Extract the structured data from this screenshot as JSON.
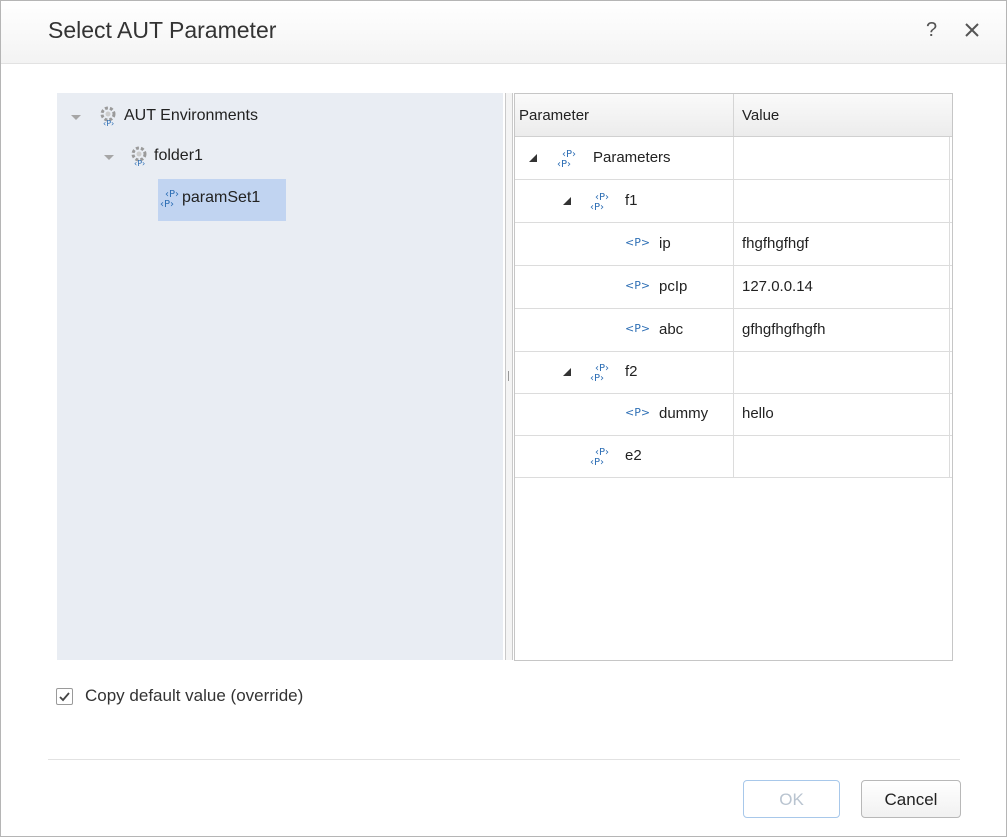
{
  "dialog": {
    "title": "Select AUT Parameter",
    "help_label": "?"
  },
  "tree": {
    "root": {
      "label": "AUT Environments",
      "icon": "gear-param-icon"
    },
    "folder": {
      "label": "folder1",
      "icon": "gear-param-icon"
    },
    "selected": {
      "label": "paramSet1",
      "icon": "param-set-icon"
    }
  },
  "grid": {
    "columns": [
      "Parameter",
      "Value"
    ],
    "rows": [
      {
        "name": "Parameters",
        "value": "",
        "kind": "group"
      },
      {
        "name": "f1",
        "value": "",
        "kind": "group"
      },
      {
        "name": "ip",
        "value": "fhgfhgfhgf",
        "kind": "param"
      },
      {
        "name": "pcIp",
        "value": "127.0.0.14",
        "kind": "param"
      },
      {
        "name": "abc",
        "value": "gfhgfhgfhgfh",
        "kind": "param"
      },
      {
        "name": "f2",
        "value": "",
        "kind": "group"
      },
      {
        "name": "dummy",
        "value": "hello",
        "kind": "param"
      },
      {
        "name": "e2",
        "value": "",
        "kind": "group"
      }
    ],
    "param_icon_text": "<P>"
  },
  "options": {
    "copy_default_label": "Copy default value (override)",
    "copy_default_checked": true
  },
  "buttons": {
    "ok_label": "OK",
    "cancel_label": "Cancel"
  },
  "colors": {
    "selection": "#c1d4f1",
    "tree_background": "#e9edf3",
    "icon_blue": "#2e6fb5"
  }
}
